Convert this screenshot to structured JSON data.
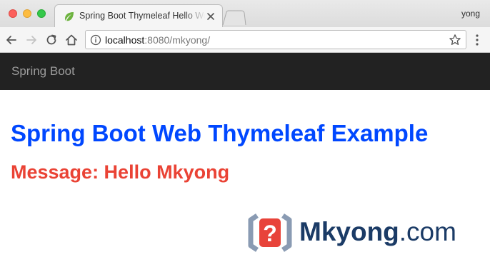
{
  "browser": {
    "tab": {
      "title": "Spring Boot Thymeleaf Hello World Example"
    },
    "profile_name": "yong",
    "address_bar": {
      "url_host": "localhost",
      "url_rest": ":8080/mkyong/"
    }
  },
  "page": {
    "navbar": {
      "brand": "Spring Boot"
    },
    "heading": "Spring Boot Web Thymeleaf Example",
    "message": "Message: Hello Mkyong"
  },
  "watermark": {
    "logo_mark": "?",
    "brand": "Mkyong",
    "domain": ".com"
  },
  "icons": {
    "favicon": "leaf-icon",
    "tab_close": "close-icon",
    "back": "back-arrow-icon",
    "forward": "forward-arrow-icon",
    "reload": "reload-icon",
    "home": "home-icon",
    "site_info": "info-icon",
    "bookmark": "star-icon",
    "menu": "kebab-menu-icon"
  },
  "colors": {
    "heading": "#0047ff",
    "message": "#ea4335",
    "navbar_bg": "#222222",
    "navbar_brand": "#9d9d9d",
    "watermark_text": "#1b3b66",
    "watermark_accent": "#e8433a"
  }
}
